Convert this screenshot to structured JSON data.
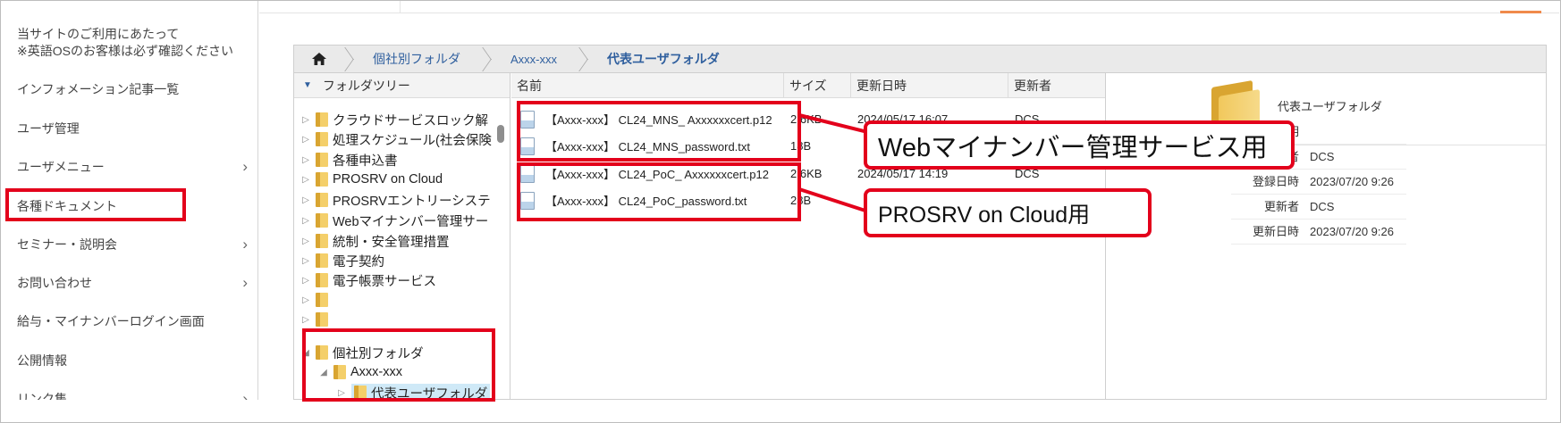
{
  "left_nav": {
    "notice_line1": "当サイトのご利用にあたって",
    "notice_line2": "※英語OSのお客様は必ず確認ください",
    "items": [
      {
        "label": "インフォメーション記事一覧",
        "chevron": false
      },
      {
        "label": "ユーザ管理",
        "chevron": false
      },
      {
        "label": "ユーザメニュー",
        "chevron": true
      },
      {
        "label": "各種ドキュメント",
        "chevron": false
      },
      {
        "label": "セミナー・説明会",
        "chevron": true
      },
      {
        "label": "お問い合わせ",
        "chevron": true
      },
      {
        "label": "給与・マイナンバーログイン画面",
        "chevron": false
      },
      {
        "label": "公開情報",
        "chevron": false
      },
      {
        "label": "リンク集",
        "chevron": true
      }
    ],
    "chevron_glyph": "›"
  },
  "breadcrumb": {
    "home_icon": "home-icon",
    "items": [
      "個社別フォルダ",
      "Axxx-xxx",
      "代表ユーザフォルダ"
    ]
  },
  "folder_tree": {
    "header": "フォルダツリー",
    "items": [
      {
        "label": "クラウドサービスロック解"
      },
      {
        "label": "処理スケジュール(社会保険"
      },
      {
        "label": "各種申込書"
      },
      {
        "label": "PROSRV on Cloud"
      },
      {
        "label": "PROSRVエントリーシステ"
      },
      {
        "label": "Webマイナンバー管理サー"
      },
      {
        "label": "統制・安全管理措置"
      },
      {
        "label": "電子契約"
      },
      {
        "label": "電子帳票サービス"
      },
      {
        "label": ""
      },
      {
        "label": ""
      },
      {
        "label": "個社別フォルダ"
      },
      {
        "label": "Axxx-xxx"
      },
      {
        "label": "代表ユーザフォルダ"
      }
    ]
  },
  "file_list": {
    "columns": [
      "名前",
      "サイズ",
      "更新日時",
      "更新者"
    ],
    "rows": [
      {
        "name": "【Axxx-xxx】 CL24_MNS_ Axxxxxxcert.p12",
        "size": "2.6KB",
        "date": "2024/05/17 16:07",
        "user": "DCS"
      },
      {
        "name": "【Axxx-xxx】 CL24_MNS_password.txt",
        "size": "18B",
        "date": "",
        "user": ""
      },
      {
        "name": "【Axxx-xxx】 CL24_PoC_ Axxxxxxcert.p12",
        "size": "2.6KB",
        "date": "2024/05/17 14:19",
        "user": "DCS"
      },
      {
        "name": "【Axxx-xxx】 CL24_PoC_password.txt",
        "size": "28B",
        "date": "",
        "user": ""
      }
    ]
  },
  "preview": {
    "folder_name": "代表ユーザフォルダ",
    "properties": [
      {
        "label": "説明",
        "value": ""
      },
      {
        "label": "登録者",
        "value": "DCS"
      },
      {
        "label": "登録日時",
        "value": "2023/07/20 9:26"
      },
      {
        "label": "更新者",
        "value": "DCS"
      },
      {
        "label": "更新日時",
        "value": "2023/07/20 9:26"
      }
    ]
  },
  "annotations": {
    "callout_mns": "Webマイナンバー管理サービス用",
    "callout_poc": "PROSRV on Cloud用",
    "highlight_color": "#e3001b"
  }
}
